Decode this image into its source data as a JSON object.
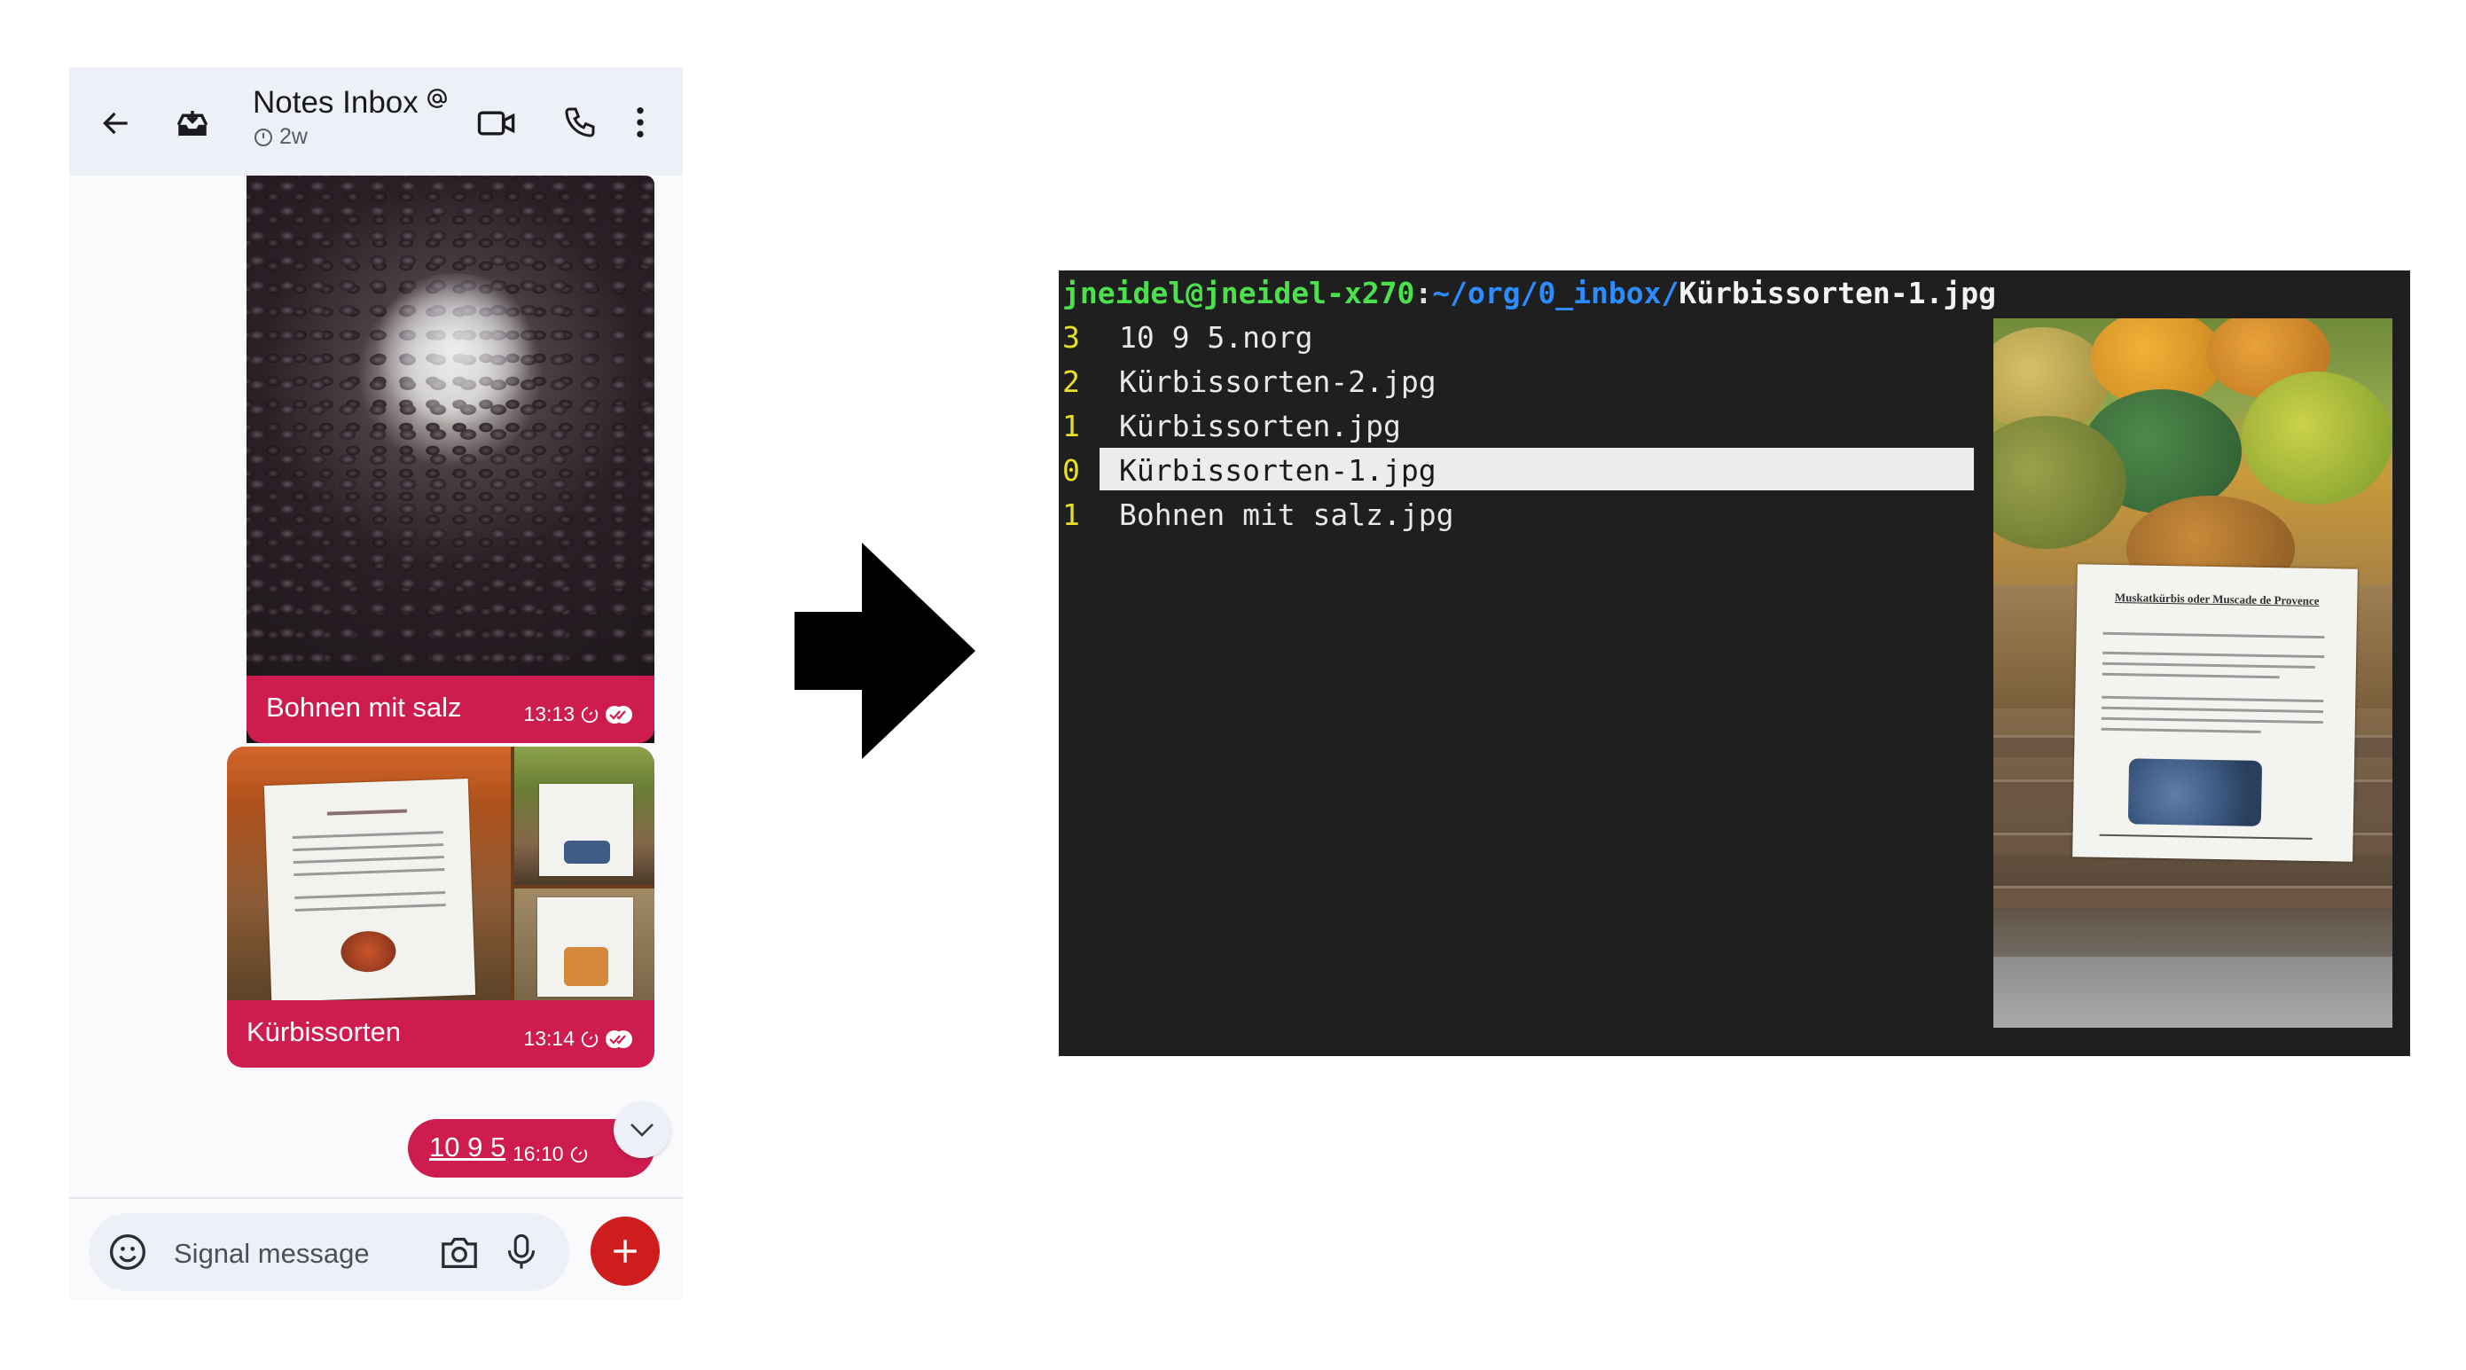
{
  "phone": {
    "header": {
      "title": "Notes Inbox",
      "subtitle": "2w"
    },
    "messages": [
      {
        "caption": "Bohnen mit salz",
        "time": "13:13"
      },
      {
        "caption": "Kürbissorten",
        "time": "13:14"
      },
      {
        "link_text": "10 9 5",
        "time": "16:10"
      }
    ],
    "composer": {
      "placeholder": "Signal message"
    }
  },
  "terminal": {
    "prompt": {
      "user_host": "jneidel@jneidel-x270",
      "separator": ":",
      "dir": "~/org/0_inbox/",
      "file": "Kürbissorten-1.jpg"
    },
    "entries": [
      {
        "num": "3",
        "name": "10 9 5.norg",
        "selected": false
      },
      {
        "num": "2",
        "name": "Kürbissorten-2.jpg",
        "selected": false
      },
      {
        "num": "1",
        "name": "Kürbissorten.jpg",
        "selected": false
      },
      {
        "num": "0",
        "name": "Kürbissorten-1.jpg",
        "selected": true
      },
      {
        "num": "1",
        "name": "Bohnen mit salz.jpg",
        "selected": false
      }
    ],
    "preview": {
      "sign_title": "Muskatkürbis oder Muscade de Provence"
    }
  },
  "colors": {
    "signal_red": "#cf1c4e",
    "terminal_bg": "#1f1f1f",
    "prompt_user": "#4ce04c",
    "prompt_dir": "#2d8cff",
    "line_number": "#e7e029"
  }
}
